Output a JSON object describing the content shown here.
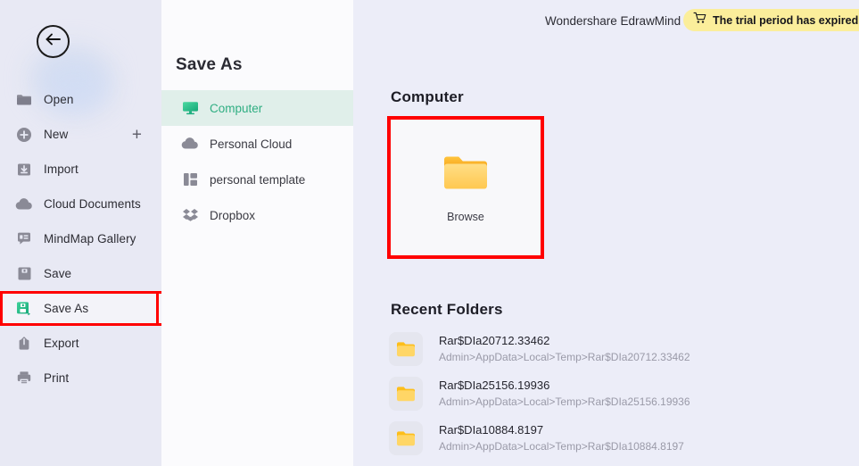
{
  "sidebar": {
    "back_button": {
      "name": "back-arrow",
      "icon": "arrow-left-icon"
    },
    "items": [
      {
        "label": "Open",
        "icon": "folder-icon",
        "selected": false,
        "trailing": ""
      },
      {
        "label": "New",
        "icon": "plus-circle-icon",
        "selected": false,
        "trailing": "+"
      },
      {
        "label": "Import",
        "icon": "import-icon",
        "selected": false,
        "trailing": ""
      },
      {
        "label": "Cloud Documents",
        "icon": "cloud-icon",
        "selected": false,
        "trailing": ""
      },
      {
        "label": "MindMap Gallery",
        "icon": "mindmap-icon",
        "selected": false,
        "trailing": ""
      },
      {
        "label": "Save",
        "icon": "save-icon",
        "selected": false,
        "trailing": ""
      },
      {
        "label": "Save As",
        "icon": "save-as-icon",
        "selected": true,
        "trailing": ""
      },
      {
        "label": "Export",
        "icon": "export-icon",
        "selected": false,
        "trailing": ""
      },
      {
        "label": "Print",
        "icon": "printer-icon",
        "selected": false,
        "trailing": ""
      }
    ]
  },
  "midpanel": {
    "title": "Save As",
    "destinations": [
      {
        "label": "Computer",
        "icon": "monitor-icon",
        "active": true
      },
      {
        "label": "Personal Cloud",
        "icon": "cloud-icon",
        "active": false
      },
      {
        "label": "personal template",
        "icon": "template-icon",
        "active": false
      },
      {
        "label": "Dropbox",
        "icon": "dropbox-icon",
        "active": false
      }
    ]
  },
  "header": {
    "app_name": "Wondershare EdrawMind",
    "trial_banner": {
      "icon": "cart-icon",
      "text": "The trial period has expired. Up"
    }
  },
  "content": {
    "computer_title": "Computer",
    "browse": {
      "label": "Browse",
      "icon": "folder-icon"
    },
    "recent_title": "Recent Folders",
    "recent_folders": [
      {
        "name": "Rar$DIa20712.33462",
        "path": "Admin>AppData>Local>Temp>Rar$DIa20712.33462",
        "icon": "folder-icon"
      },
      {
        "name": "Rar$DIa25156.19936",
        "path": "Admin>AppData>Local>Temp>Rar$DIa25156.19936",
        "icon": "folder-icon"
      },
      {
        "name": "Rar$DIa10884.8197",
        "path": "Admin>AppData>Local>Temp>Rar$DIa10884.8197",
        "icon": "folder-icon"
      }
    ]
  },
  "colors": {
    "sidebar_bg": "#E8E9F4",
    "midpanel_bg": "#FBFBFD",
    "content_bg": "#ECEDF8",
    "accent_green": "#2FAE82",
    "active_row_bg": "#E0EFEA",
    "highlight_red": "#FF0000",
    "trial_yellow": "#FBEE9B",
    "folder_yellow": "#FFC83D"
  }
}
